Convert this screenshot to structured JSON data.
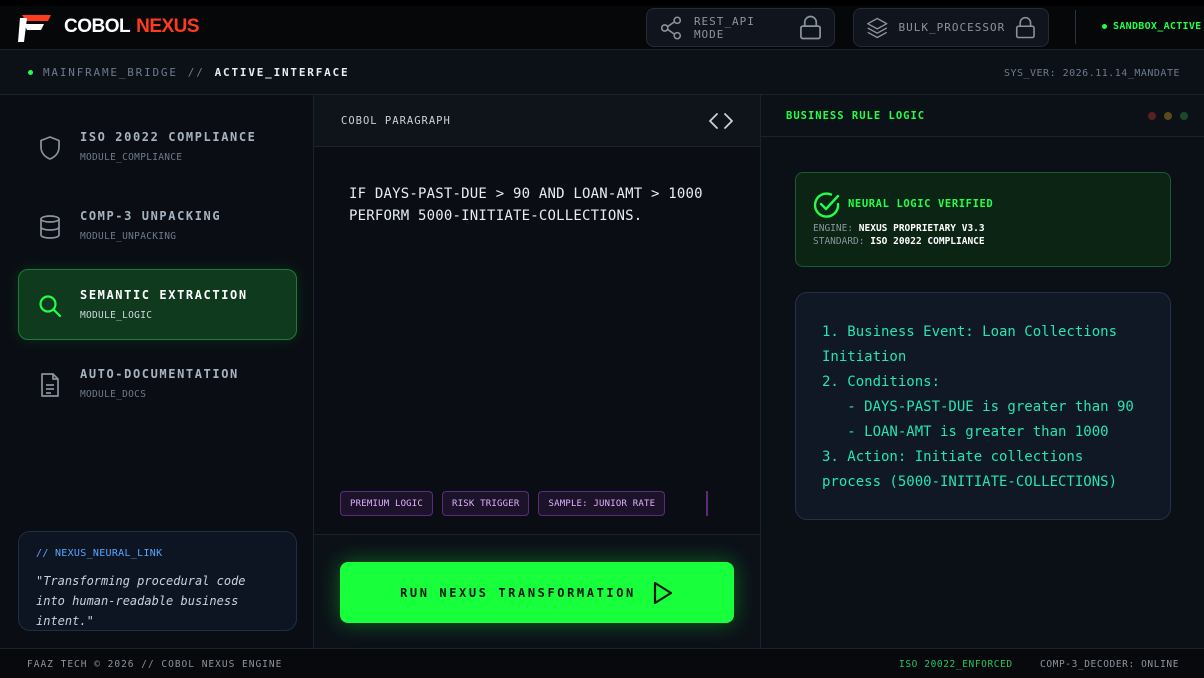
{
  "brand": {
    "name_white": "COBOL",
    "name_red": "NEXUS"
  },
  "header": {
    "rest_api_label": "REST_API MODE",
    "bulk_label": "BULK_PROCESSOR",
    "sandbox_label": "SANDBOX_ACTIVE"
  },
  "breadcrumb": {
    "root": "MAINFRAME_BRIDGE",
    "sep": "//",
    "current": "ACTIVE_INTERFACE"
  },
  "sys_ver": "SYS_VER: 2026.11.14_MANDATE",
  "sidebar": {
    "items": [
      {
        "title": "ISO 20022 COMPLIANCE",
        "sub": "MODULE_COMPLIANCE",
        "icon": "shield-icon"
      },
      {
        "title": "COMP-3 UNPACKING",
        "sub": "MODULE_UNPACKING",
        "icon": "database-icon"
      },
      {
        "title": "SEMANTIC EXTRACTION",
        "sub": "MODULE_LOGIC",
        "icon": "search-icon",
        "selected": true
      },
      {
        "title": "AUTO-DOCUMENTATION",
        "sub": "MODULE_DOCS",
        "icon": "document-icon"
      }
    ],
    "neural": {
      "heading": "// NEXUS_NEURAL_LINK",
      "quote": "\"Transforming procedural code into human-readable business intent.\""
    }
  },
  "center": {
    "title": "COBOL PARAGRAPH",
    "code_line1": "IF DAYS-PAST-DUE > 90 AND LOAN-AMT > 1000",
    "code_line2": "PERFORM 5000-INITIATE-COLLECTIONS.",
    "tags": [
      "PREMIUM LOGIC",
      "RISK TRIGGER",
      "SAMPLE: JUNIOR RATE"
    ],
    "run_label": "RUN NEXUS TRANSFORMATION"
  },
  "right": {
    "title": "BUSINESS RULE LOGIC",
    "verified": {
      "title": "NEURAL LOGIC VERIFIED",
      "engine_key": "ENGINE:",
      "engine_val": "NEXUS PROPRIETARY V3.3",
      "standard_key": "STANDARD:",
      "standard_val": "ISO 20022 COMPLIANCE"
    },
    "rules": [
      "1. Business Event: Loan Collections",
      "Initiation",
      "2. Conditions:",
      "   - DAYS-PAST-DUE is greater than 90",
      "   - LOAN-AMT is greater than 1000",
      "3. Action: Initiate collections",
      "process (5000-INITIATE-COLLECTIONS)"
    ]
  },
  "footer": {
    "left": "FAAZ TECH © 2026 // COBOL NEXUS ENGINE",
    "iso": "ISO 20022_ENFORCED",
    "decoder": "COMP-3_DECODER: ONLINE"
  },
  "colors": {
    "accent_green": "#18ff3c",
    "brand_red": "#ff3b1f",
    "rule_teal": "#23e6b3"
  }
}
